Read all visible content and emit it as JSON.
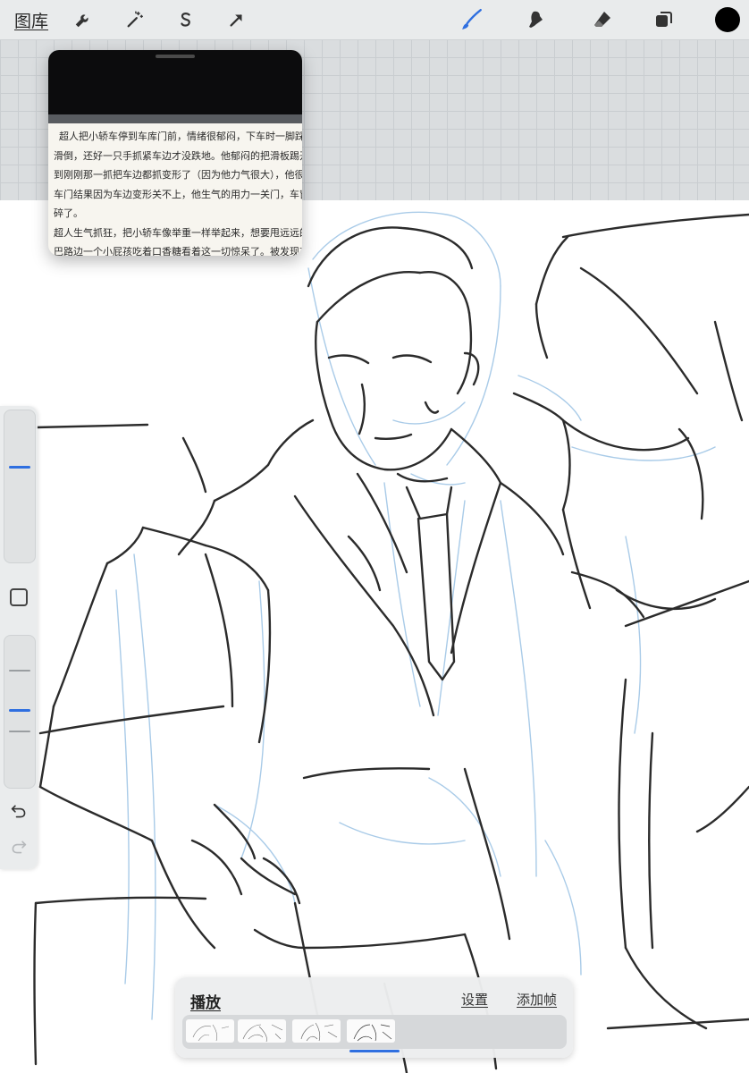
{
  "toolbar": {
    "gallery_label": "图库",
    "actions_icon": "wrench-icon",
    "adjustments_icon": "magic-wand-icon",
    "selection_icon": "selection-s-icon",
    "transform_icon": "arrow-cursor-icon",
    "brush_icon": "brush-icon",
    "smudge_icon": "smudge-icon",
    "eraser_icon": "eraser-icon",
    "layers_icon": "layers-icon",
    "active_color": "#000000",
    "active_tool_color": "#2f6fe0"
  },
  "reference": {
    "lines": [
      "超人把小轿车停到车库门前，情绪很郁闷，下车时一脚踩到滑",
      "滑倒，还好一只手抓紧车边才没跌地。他郁闷的把滑板踢开，",
      "到刚刚那一抓把车边都抓变形了（因为他力气很大），他很郁",
      "车门结果因为车边变形关不上，他生气的用力一关门，车窗玻",
      "碎了。",
      "超人生气抓狂，把小轿车像举重一样举起来，想要甩远远的，",
      "巴路边一个小屁孩吃着口香糖看着这一切惊呆了。被发现有起"
    ]
  },
  "sidebar": {
    "brush_size_level": 0.62,
    "opacity_level": 0.5,
    "undo_icon": "undo-icon",
    "redo_icon": "redo-icon"
  },
  "animation": {
    "play_label": "播放",
    "settings_label": "设置",
    "add_frame_label": "添加帧",
    "frames": 4,
    "selected_frame": 4
  }
}
